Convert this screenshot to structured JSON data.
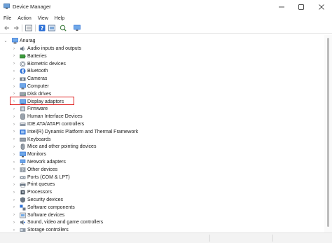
{
  "window": {
    "title": "Device Manager",
    "icon": "device-manager-icon",
    "controls": [
      "minimize-icon",
      "maximize-icon",
      "close-icon"
    ]
  },
  "menu": [
    {
      "label": "File"
    },
    {
      "label": "Action"
    },
    {
      "label": "View"
    },
    {
      "label": "Help"
    }
  ],
  "toolbar": [
    "back-arrow-icon",
    "forward-arrow-icon",
    "properties-icon",
    "help-icon",
    "update-driver-icon",
    "scan-hardware-icon",
    "monitor-icon"
  ],
  "tree": {
    "root": {
      "label": "Anurag",
      "icon": "computer-icon"
    },
    "items": [
      {
        "label": "Audio inputs and outputs",
        "icon": "speaker-icon"
      },
      {
        "label": "Batteries",
        "icon": "battery-icon"
      },
      {
        "label": "Biometric devices",
        "icon": "fingerprint-icon"
      },
      {
        "label": "Bluetooth",
        "icon": "bluetooth-icon"
      },
      {
        "label": "Cameras",
        "icon": "camera-icon"
      },
      {
        "label": "Computer",
        "icon": "computer-icon"
      },
      {
        "label": "Disk drives",
        "icon": "disk-icon"
      },
      {
        "label": "Display adaptors",
        "icon": "display-adapter-icon"
      },
      {
        "label": "Firmware",
        "icon": "firmware-icon"
      },
      {
        "label": "Human Interface Devices",
        "icon": "hid-icon"
      },
      {
        "label": "IDE ATA/ATAPI controllers",
        "icon": "ide-controller-icon"
      },
      {
        "label": "Intel(R) Dynamic Platform and Thermal Framework",
        "icon": "intel-icon"
      },
      {
        "label": "Keyboards",
        "icon": "keyboard-icon"
      },
      {
        "label": "Mice and other pointing devices",
        "icon": "mouse-icon"
      },
      {
        "label": "Monitors",
        "icon": "monitor-icon"
      },
      {
        "label": "Network adapters",
        "icon": "network-icon"
      },
      {
        "label": "Other devices",
        "icon": "unknown-device-icon"
      },
      {
        "label": "Ports (COM & LPT)",
        "icon": "port-icon"
      },
      {
        "label": "Print queues",
        "icon": "printer-icon"
      },
      {
        "label": "Processors",
        "icon": "processor-icon"
      },
      {
        "label": "Security devices",
        "icon": "security-icon"
      },
      {
        "label": "Software components",
        "icon": "software-component-icon"
      },
      {
        "label": "Software devices",
        "icon": "software-device-icon"
      },
      {
        "label": "Sound, video and game controllers",
        "icon": "sound-icon"
      },
      {
        "label": "Storage controllers",
        "icon": "storage-icon"
      }
    ]
  },
  "colors": {
    "highlight_border": "#e02020",
    "icon_blue": "#2b6fd6",
    "icon_gray": "#6b7785"
  }
}
